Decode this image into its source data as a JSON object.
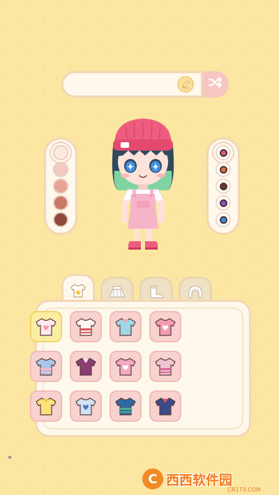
{
  "name_bar": {
    "value": "",
    "placeholder": ""
  },
  "icons": {
    "edit": "pencil-icon",
    "shuffle": "shuffle-icon",
    "tab_tops": "tshirt-star-icon",
    "tab_skirts": "skirt-icon",
    "tab_shoes": "boots-icon",
    "tab_hair": "hair-icon"
  },
  "skin_tones": [
    {
      "color": "#fde8e4",
      "selected": true
    },
    {
      "color": "#f6c8c4",
      "selected": false
    },
    {
      "color": "#e8a594",
      "selected": false
    },
    {
      "color": "#c97a65",
      "selected": false
    },
    {
      "color": "#8e4a3c",
      "selected": false
    }
  ],
  "eye_colors": [
    {
      "color": "#e05580",
      "selected": true
    },
    {
      "color": "#e0703a",
      "selected": false
    },
    {
      "color": "#6b3a2a",
      "selected": false
    },
    {
      "color": "#8a4ec8",
      "selected": false
    },
    {
      "color": "#3a8ee0",
      "selected": false
    }
  ],
  "tabs": [
    {
      "name": "tops",
      "active": true
    },
    {
      "name": "skirts",
      "active": false
    },
    {
      "name": "shoes",
      "active": false
    },
    {
      "name": "hair",
      "active": false
    }
  ],
  "items": [
    {
      "name": "heart-tee",
      "selected": true,
      "main": "#ffe9ef",
      "accent": "#f39ab3"
    },
    {
      "name": "bow-blouse",
      "selected": false,
      "main": "#fff5f2",
      "accent": "#d75a5a"
    },
    {
      "name": "teal-crop-top",
      "selected": false,
      "main": "#9fd9e5",
      "accent": "#f3a6bd"
    },
    {
      "name": "pink-jacket",
      "selected": false,
      "main": "#f59bb0",
      "accent": "#ffffff"
    },
    {
      "name": "blue-hoodie",
      "selected": false,
      "main": "#a9c6ea",
      "accent": "#f6b8c6"
    },
    {
      "name": "striped-sweater",
      "selected": false,
      "main": "#8b3e72",
      "accent": "#f4e3ef"
    },
    {
      "name": "pink-sweatshirt",
      "selected": false,
      "main": "#f4a9c2",
      "accent": "#ffffff"
    },
    {
      "name": "bow-cardigan",
      "selected": false,
      "main": "#f2c3d3",
      "accent": "#d76a98"
    },
    {
      "name": "yellow-blouse",
      "selected": false,
      "main": "#fbe07b",
      "accent": "#f0c64a"
    },
    {
      "name": "sailor-shirt",
      "selected": false,
      "main": "#cfe3f3",
      "accent": "#4b78c3"
    },
    {
      "name": "anchor-top",
      "selected": false,
      "main": "#2e6aa1",
      "accent": "#4fb28f"
    },
    {
      "name": "denim-jacket",
      "selected": false,
      "main": "#3b4a88",
      "accent": "#e35b5b"
    }
  ],
  "watermark": {
    "logo": "C",
    "text": "西西软件园",
    "sub": "CR173.COM"
  }
}
